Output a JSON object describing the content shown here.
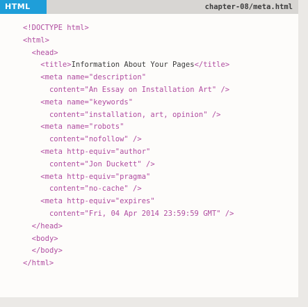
{
  "header": {
    "language_label": "HTML",
    "file_path": "chapter-08/meta.html"
  },
  "code_lines": [
    {
      "indent": "",
      "pre": "",
      "tag": "<!DOCTYPE html>",
      "text": "",
      "close": ""
    },
    {
      "indent": "",
      "pre": "",
      "tag": "<html>",
      "text": "",
      "close": ""
    },
    {
      "indent": "  ",
      "pre": "",
      "tag": "<head>",
      "text": "",
      "close": ""
    },
    {
      "indent": "    ",
      "pre": "",
      "tag": "<title>",
      "text": "Information About Your Pages",
      "close": "</title>"
    },
    {
      "indent": "    ",
      "pre": "",
      "tag": "<meta name=\"description\"",
      "text": "",
      "close": ""
    },
    {
      "indent": "      ",
      "pre": "",
      "tag": "content=\"An Essay on Installation Art\" />",
      "text": "",
      "close": ""
    },
    {
      "indent": "    ",
      "pre": "",
      "tag": "<meta name=\"keywords\"",
      "text": "",
      "close": ""
    },
    {
      "indent": "      ",
      "pre": "",
      "tag": "content=\"installation, art, opinion\" />",
      "text": "",
      "close": ""
    },
    {
      "indent": "    ",
      "pre": "",
      "tag": "<meta name=\"robots\"",
      "text": "",
      "close": ""
    },
    {
      "indent": "      ",
      "pre": "",
      "tag": "content=\"nofollow\" />",
      "text": "",
      "close": ""
    },
    {
      "indent": "    ",
      "pre": "",
      "tag": "<meta http-equiv=\"author\"",
      "text": "",
      "close": ""
    },
    {
      "indent": "      ",
      "pre": "",
      "tag": "content=\"Jon Duckett\" />",
      "text": "",
      "close": ""
    },
    {
      "indent": "    ",
      "pre": "",
      "tag": "<meta http-equiv=\"pragma\"",
      "text": "",
      "close": ""
    },
    {
      "indent": "      ",
      "pre": "",
      "tag": "content=\"no-cache\" />",
      "text": "",
      "close": ""
    },
    {
      "indent": "    ",
      "pre": "",
      "tag": "<meta http-equiv=\"expires\"",
      "text": "",
      "close": ""
    },
    {
      "indent": "      ",
      "pre": "",
      "tag": "content=\"Fri, 04 Apr 2014 23:59:59 GMT\" />",
      "text": "",
      "close": ""
    },
    {
      "indent": "  ",
      "pre": "",
      "tag": "</head>",
      "text": "",
      "close": ""
    },
    {
      "indent": "  ",
      "pre": "",
      "tag": "<body>",
      "text": "",
      "close": ""
    },
    {
      "indent": "  ",
      "pre": "",
      "tag": "</body>",
      "text": "",
      "close": ""
    },
    {
      "indent": "",
      "pre": "",
      "tag": "</html>",
      "text": "",
      "close": ""
    }
  ],
  "colors": {
    "tag_badge": "#1f9ed9",
    "header_bar": "#d8d6d3",
    "markup": "#b04ca0",
    "text": "#3a3a3a"
  }
}
